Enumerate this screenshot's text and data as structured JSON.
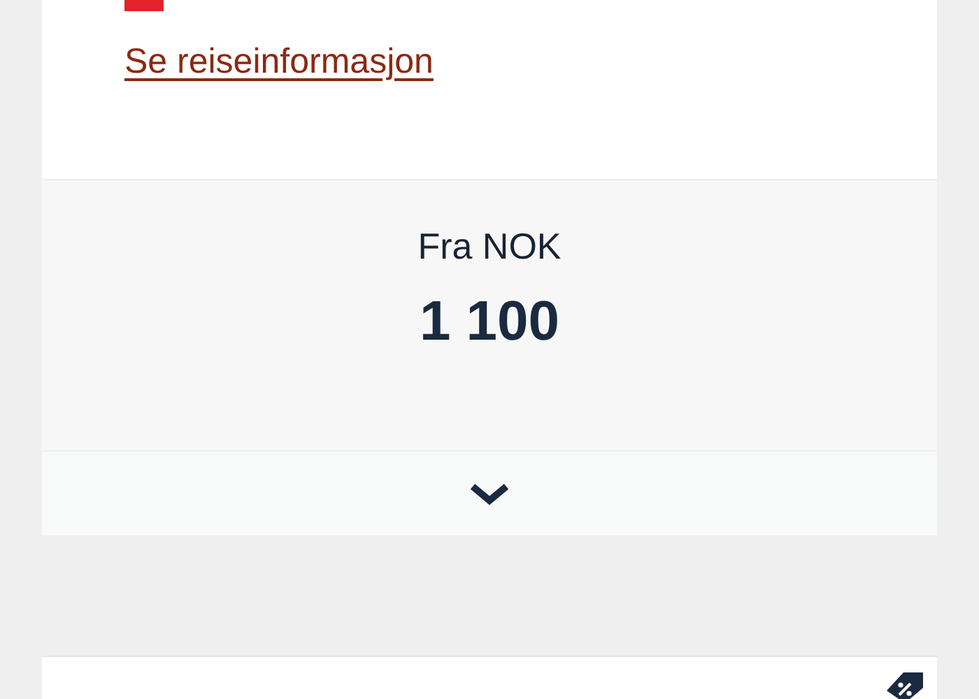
{
  "travel_link": "Se reiseinformasjon",
  "price": {
    "prefix": "Fra NOK",
    "amount": "1 100"
  },
  "expand": {
    "expanded": false
  }
}
